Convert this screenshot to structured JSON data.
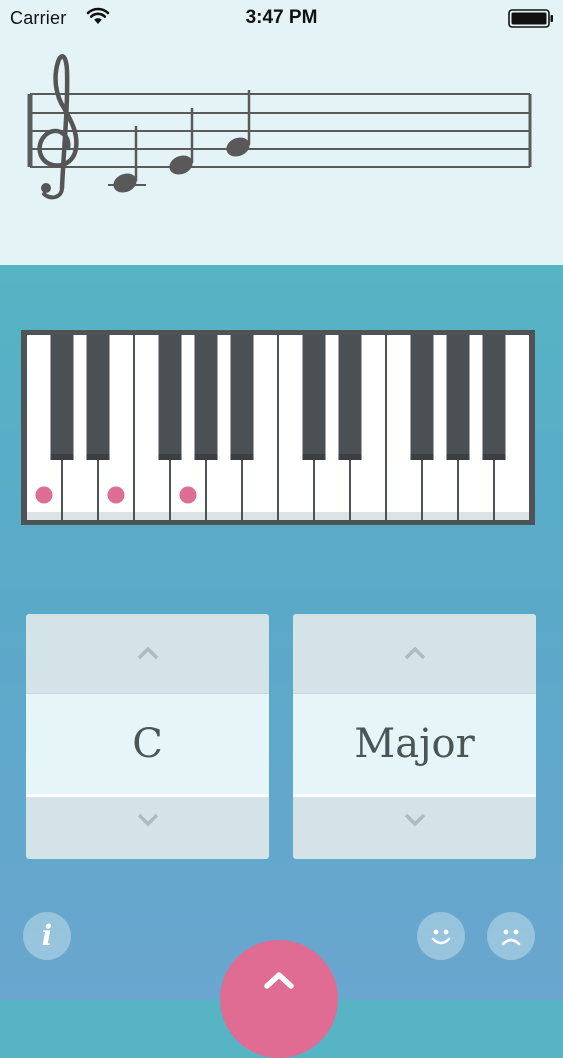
{
  "status_bar": {
    "carrier": "Carrier",
    "time": "3:47 PM",
    "wifi_icon": "wifi-icon",
    "battery_icon": "battery-icon"
  },
  "staff": {
    "clef": "treble",
    "notes": [
      "C",
      "D",
      "E"
    ]
  },
  "keyboard": {
    "white_key_count": 14,
    "highlighted_white_keys": [
      0,
      2,
      4
    ],
    "highlight_color": "#de6d95"
  },
  "pickers": {
    "root": {
      "value": "C",
      "up_icon": "chevron-up-icon",
      "down_icon": "chevron-down-icon"
    },
    "quality": {
      "value": "Major",
      "up_icon": "chevron-up-icon",
      "down_icon": "chevron-down-icon"
    }
  },
  "buttons": {
    "info": {
      "glyph": "i",
      "icon": "info-icon"
    },
    "happy": {
      "icon": "smiley-happy-icon"
    },
    "sad": {
      "icon": "smiley-sad-icon"
    },
    "play": {
      "icon": "chevron-up-icon",
      "color": "#e06b93"
    }
  },
  "colors": {
    "top_background": "#e4f4f6",
    "accent_pink": "#de6d95",
    "picker_background": "#d4e3e7",
    "text_dark": "#4a5556"
  }
}
